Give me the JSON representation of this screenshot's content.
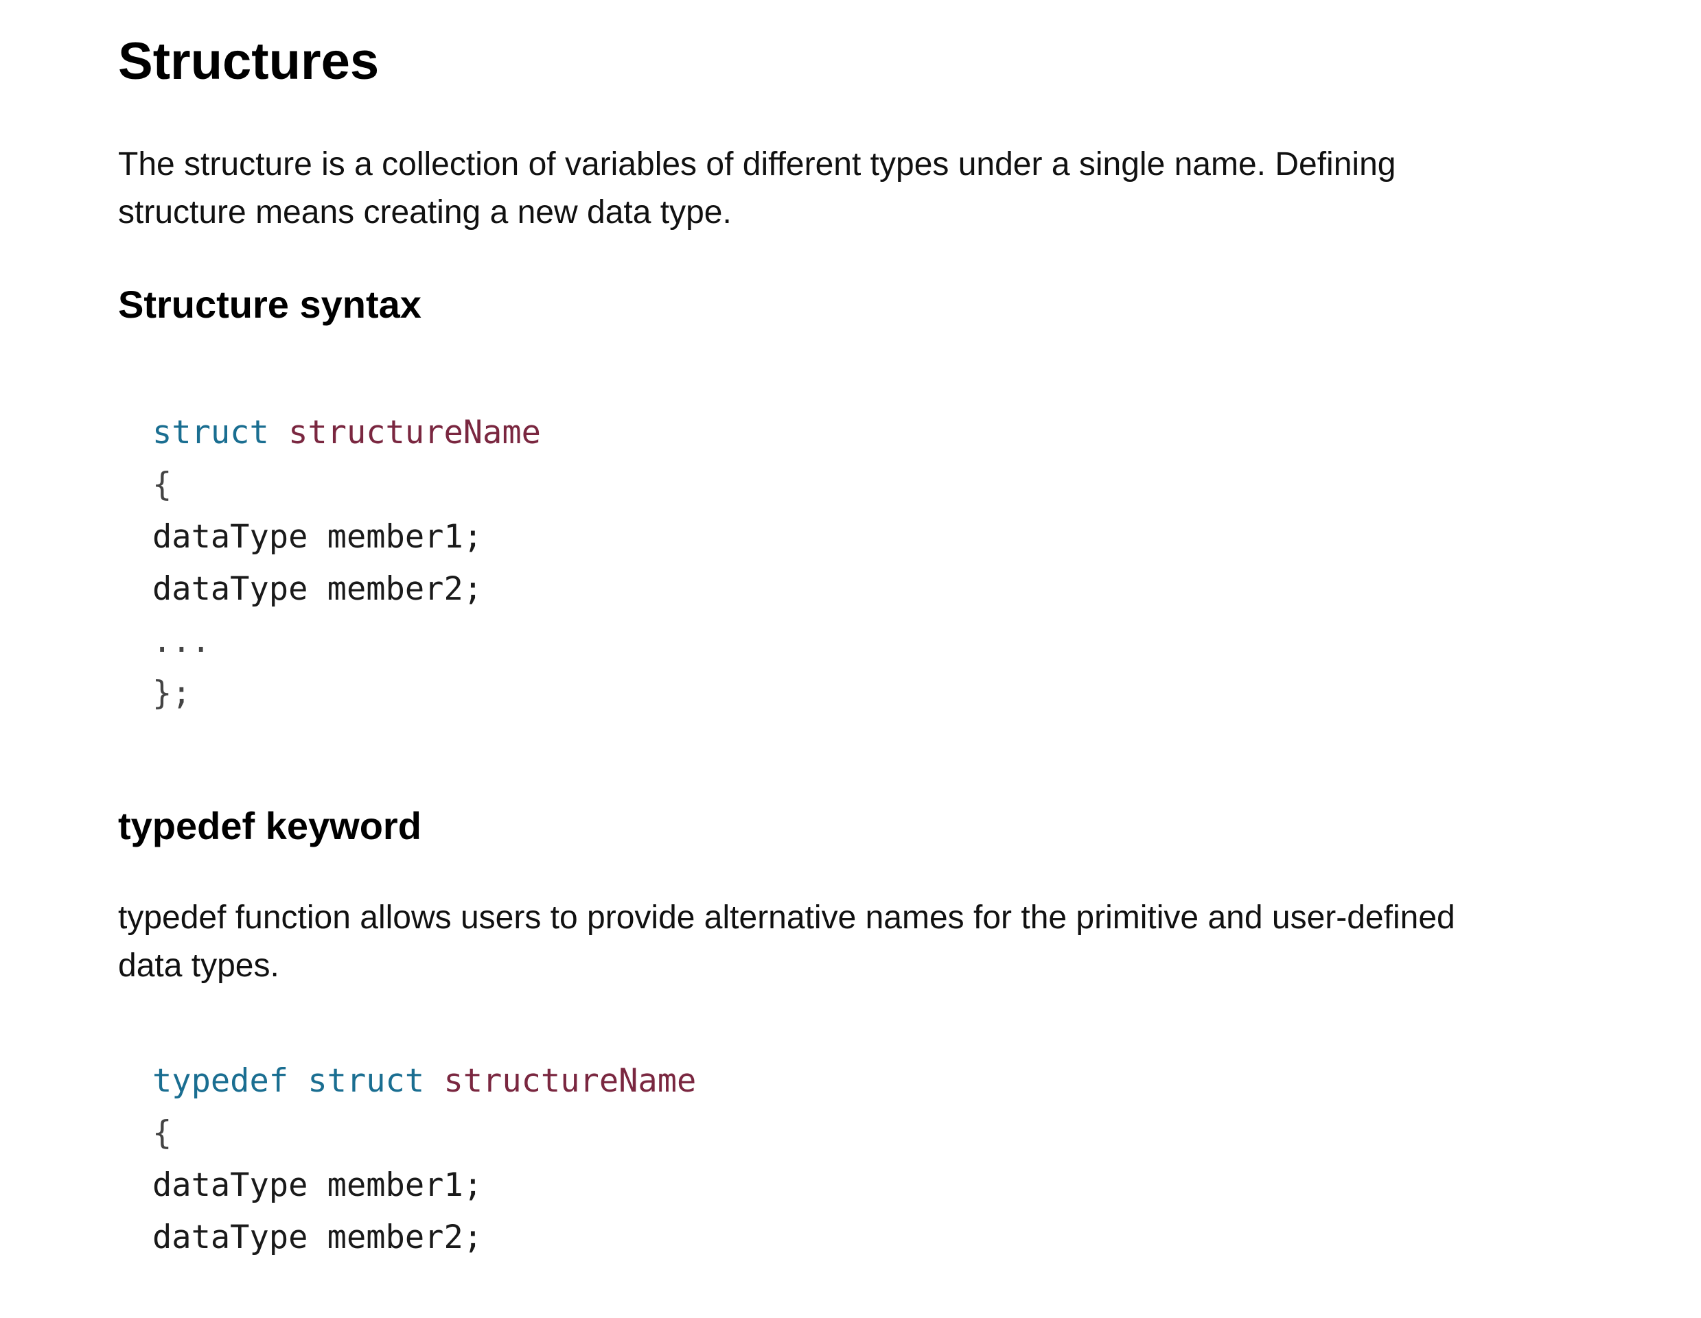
{
  "title": "Structures",
  "intro": {
    "line1": "The structure is a collection of variables of different types under a single name. Defining",
    "line2": "structure means creating a new data type."
  },
  "syntax_section": {
    "heading": "Structure syntax",
    "code": {
      "keyword": "struct",
      "name": "structureName",
      "open": "{",
      "member1": "dataType member1;",
      "member2": "dataType member2;",
      "ellipsis": "...",
      "close": "};"
    }
  },
  "typedef_section": {
    "heading": "typedef keyword",
    "desc": {
      "line1": "typedef function allows users to provide alternative names for the primitive and user-defined",
      "line2": "data types."
    },
    "code": {
      "keyword1": "typedef",
      "keyword2": "struct",
      "name": "structureName",
      "open": "{",
      "member1": "dataType member1;",
      "member2": "dataType member2;"
    }
  },
  "colors": {
    "keyword": "#1a6e91",
    "identifier": "#7a2740",
    "text": "#111111"
  }
}
